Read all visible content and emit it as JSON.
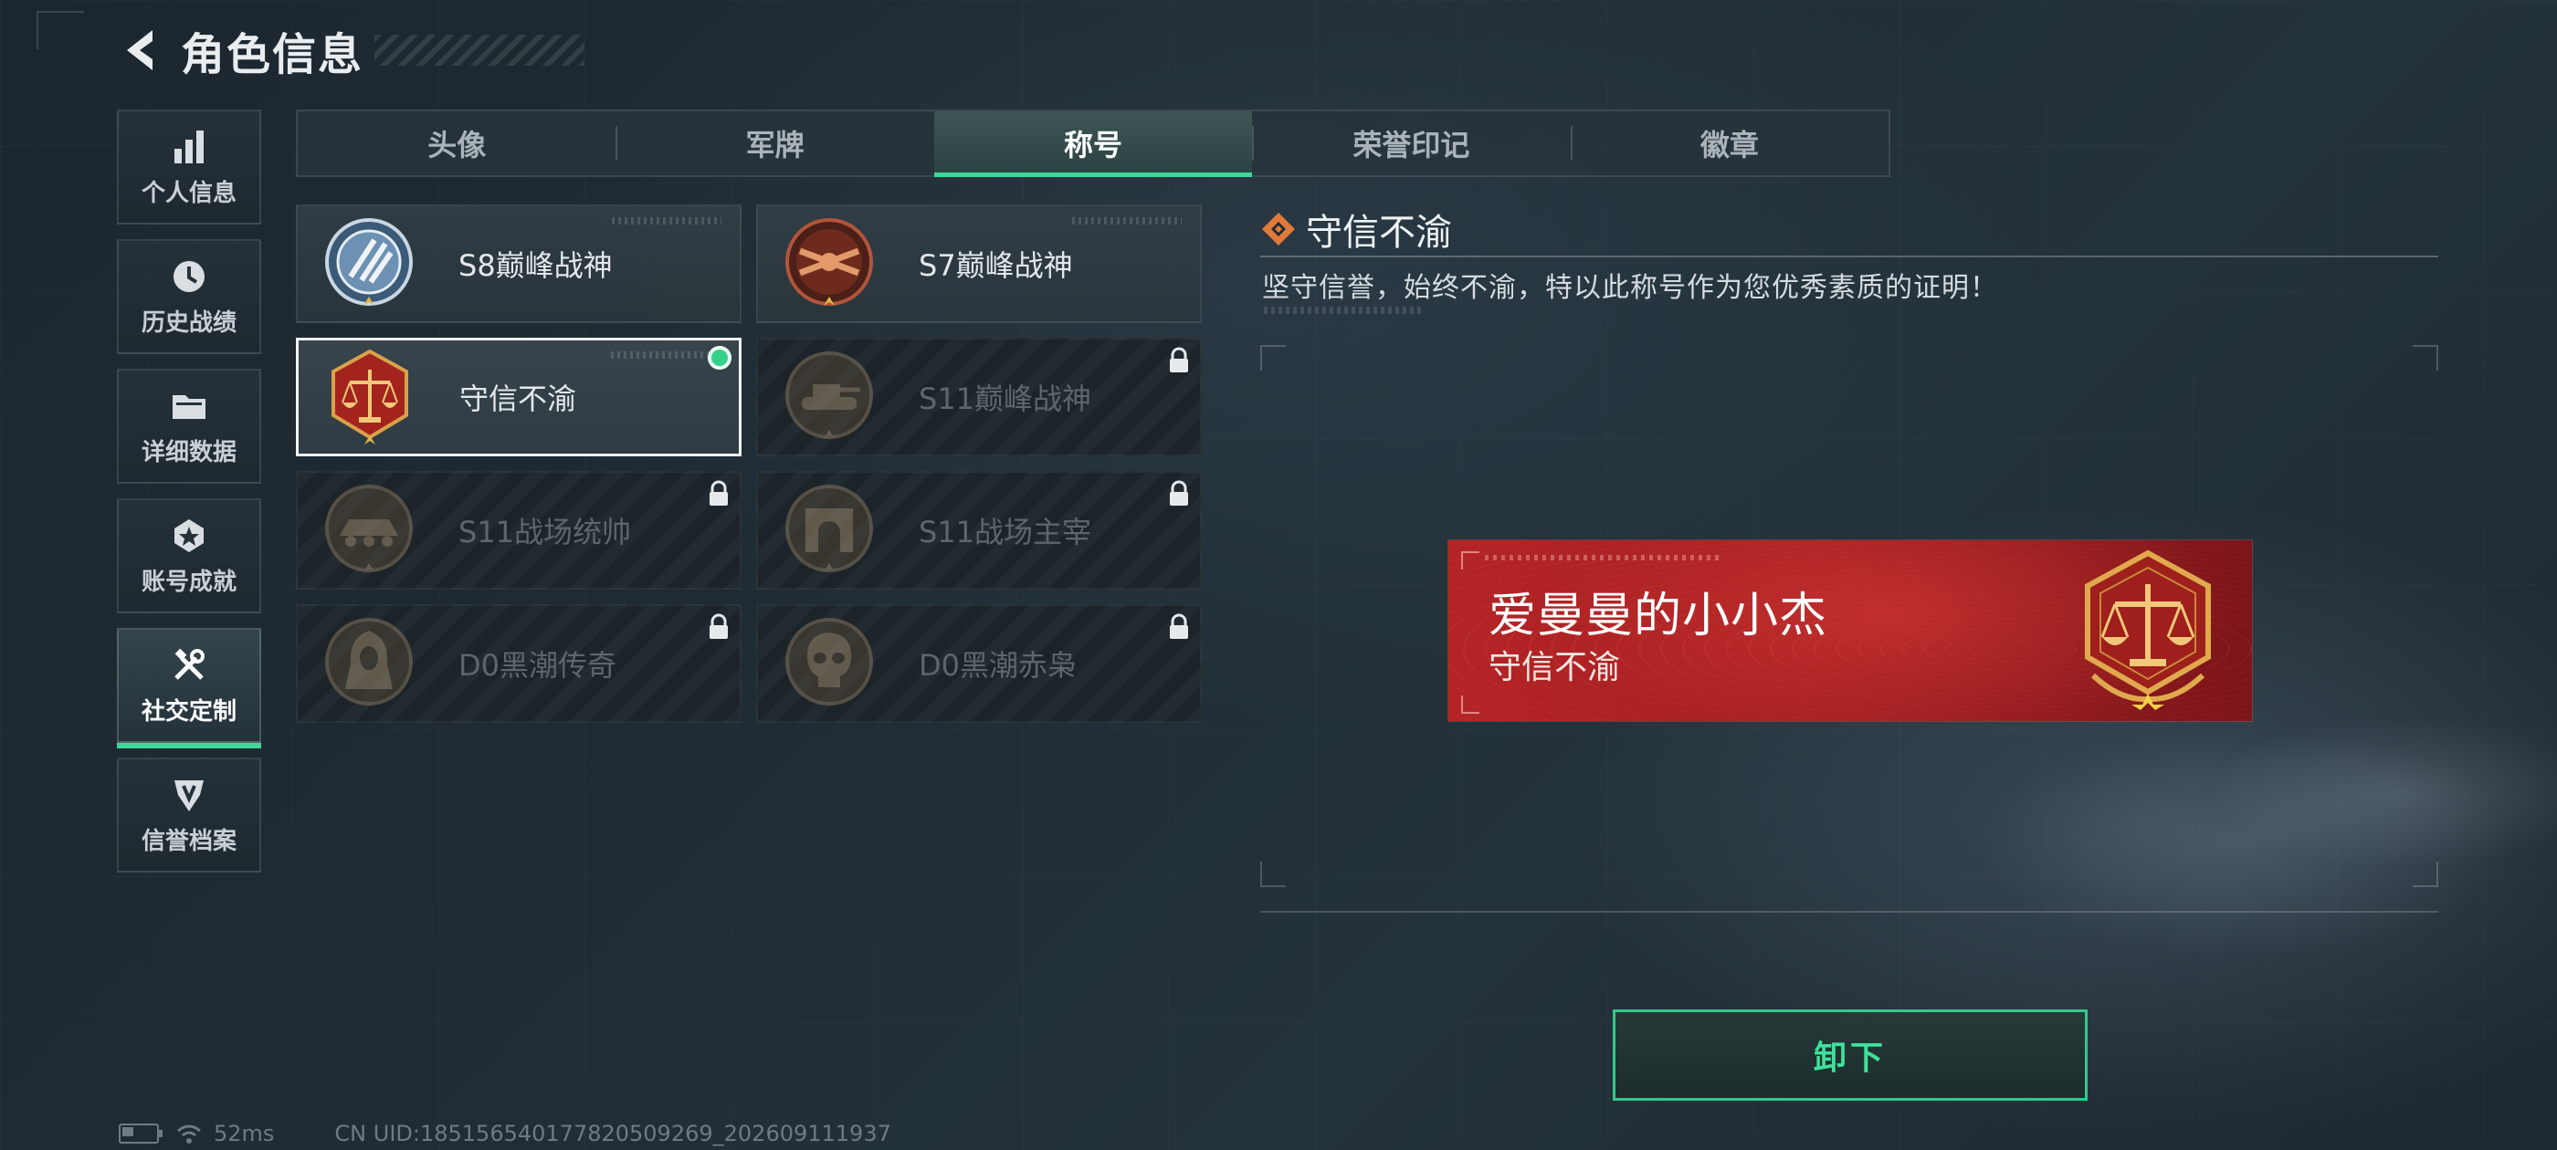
{
  "header": {
    "title": "角色信息"
  },
  "sidebar": {
    "items": [
      {
        "label": "个人信息",
        "icon": "bar-chart-icon"
      },
      {
        "label": "历史战绩",
        "icon": "clock-icon"
      },
      {
        "label": "详细数据",
        "icon": "folder-icon"
      },
      {
        "label": "账号成就",
        "icon": "achievement-icon"
      },
      {
        "label": "社交定制",
        "icon": "tools-icon",
        "active": true
      },
      {
        "label": "信誉档案",
        "icon": "emblem-icon"
      }
    ]
  },
  "tabs": [
    {
      "label": "头像"
    },
    {
      "label": "军牌"
    },
    {
      "label": "称号",
      "active": true
    },
    {
      "label": "荣誉印记"
    },
    {
      "label": "徽章"
    }
  ],
  "titles": [
    {
      "name": "S8巅峰战神",
      "medal": "blue-wings-medal-icon",
      "locked": false
    },
    {
      "name": "S7巅峰战神",
      "medal": "crossed-rifles-medal-icon",
      "locked": false
    },
    {
      "name": "守信不渝",
      "medal": "scales-medal-icon",
      "locked": false,
      "selected": true,
      "equipped": true
    },
    {
      "name": "S11巅峰战神",
      "medal": "tank-medal-icon",
      "locked": true
    },
    {
      "name": "S11战场统帅",
      "medal": "armored-vehicle-medal-icon",
      "locked": true
    },
    {
      "name": "S11战场主宰",
      "medal": "arch-medal-icon",
      "locked": true
    },
    {
      "name": "D0黑潮传奇",
      "medal": "hooded-figure-medal-icon",
      "locked": true
    },
    {
      "name": "D0黑潮赤枭",
      "medal": "skull-medal-icon",
      "locked": true
    }
  ],
  "detail": {
    "title": "守信不渝",
    "description": "坚守信誉，始终不渝，特以此称号作为您优秀素质的证明！"
  },
  "banner": {
    "player_name": "爱曼曼的小小杰",
    "title": "守信不渝"
  },
  "actions": {
    "unequip_label": "卸下"
  },
  "footer": {
    "ping": "52ms",
    "uid": "CN UID:18515654017782050926​9_202609111937"
  },
  "colors": {
    "accent_green": "#3fd69b",
    "banner_red": "#b42426",
    "medal_gold": "#d8a24a"
  }
}
